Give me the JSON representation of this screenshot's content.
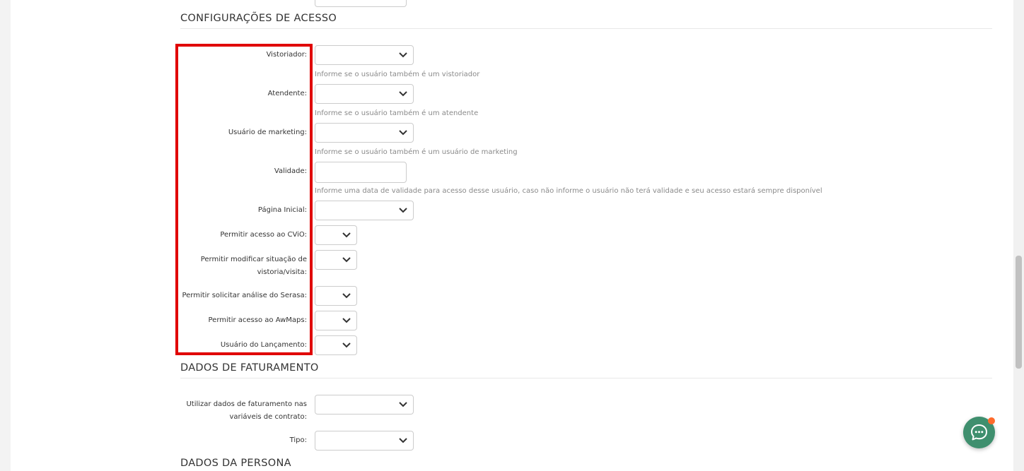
{
  "sections": {
    "access": {
      "title": "CONFIGURAÇÕES DE ACESSO"
    },
    "billing": {
      "title": "DADOS DE FATURAMENTO"
    },
    "persona": {
      "title": "DADOS DA PERSONA"
    }
  },
  "access_fields": {
    "vistoriador": {
      "label": "Vistoriador:",
      "help": "Informe se o usuário também é um vistoriador"
    },
    "atendente": {
      "label": "Atendente:",
      "help": "Informe se o usuário também é um atendente"
    },
    "marketing": {
      "label": "Usuário de marketing:",
      "help": "Informe se o usuário também é um usuário de marketing"
    },
    "validade": {
      "label": "Validade:",
      "help": "Informe uma data de validade para acesso desse usuário, caso não informe o usuário não terá validade e seu acesso estará sempre disponível"
    },
    "pagina_inicial": {
      "label": "Página Inicial:"
    },
    "cvio": {
      "label": "Permitir acesso ao CViO:"
    },
    "modificar_situacao": {
      "label_line1": "Permitir modificar situação de",
      "label_line2": "vistoria/visita:"
    },
    "serasa": {
      "label": "Permitir solicitar análise do Serasa:"
    },
    "awmaps": {
      "label": "Permitir acesso ao AwMaps:"
    },
    "lancamento": {
      "label": "Usuário do Lançamento:"
    }
  },
  "billing_fields": {
    "utilizar_dados": {
      "label_line1": "Utilizar dados de faturamento nas",
      "label_line2": "variáveis de contrato:"
    },
    "tipo": {
      "label": "Tipo:"
    }
  },
  "icons": {
    "select_arrow": "chevron-down-icon",
    "chat": "chat-bubble-icon"
  },
  "colors": {
    "highlight": "#e00000",
    "chat_button": "#3f8f6e",
    "notification_dot": "#ff6a2b"
  }
}
